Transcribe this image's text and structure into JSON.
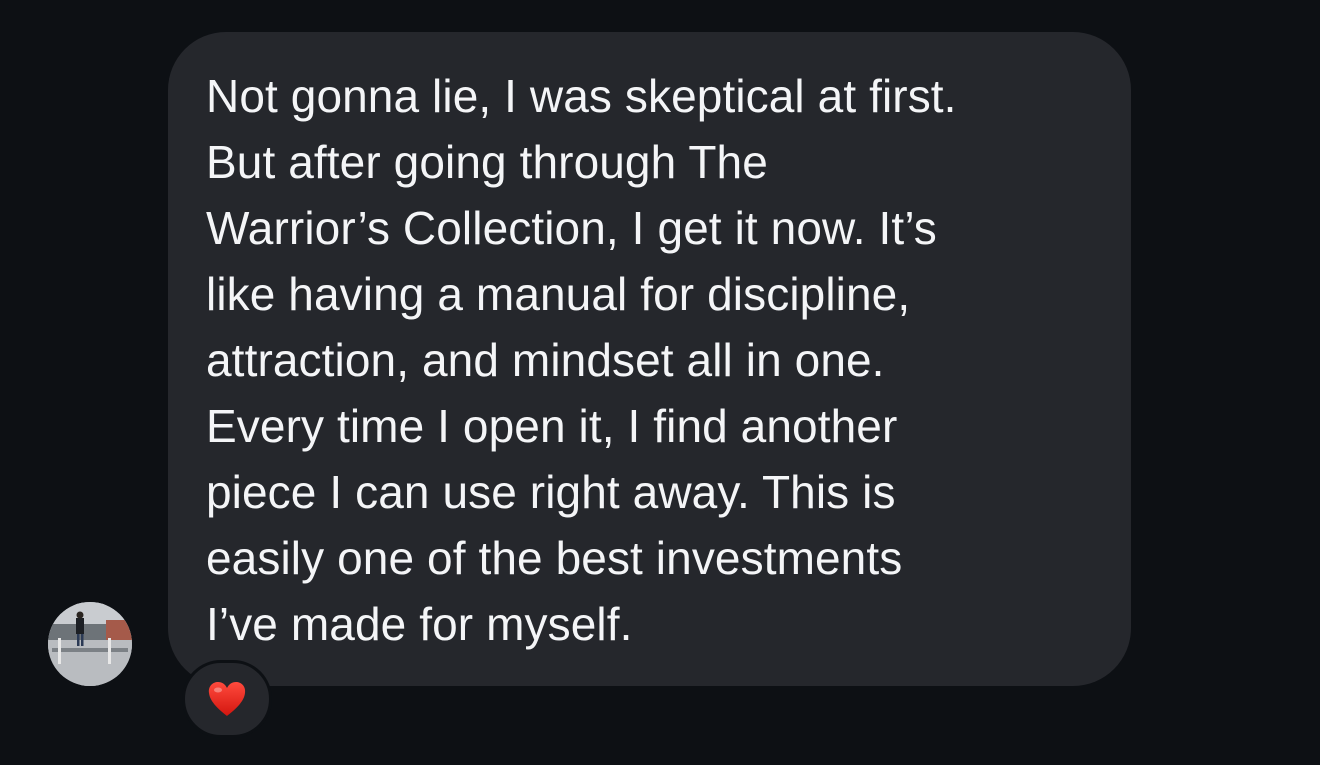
{
  "message": {
    "text": "Not gonna lie, I was skeptical at first.\nBut after going through The\nWarrior’s Collection, I get it now. It’s\nlike having a manual for discipline,\nattraction, and mindset all in one.\nEvery time I open it, I find another\npiece I can use right away. This is\neasily one of the best investments\nI’ve made for myself."
  },
  "reaction": {
    "icon": "red-heart-icon",
    "color": "#e0241c"
  },
  "colors": {
    "background": "#0d1014",
    "bubble": "#25272c",
    "text": "#f4f5f7"
  }
}
